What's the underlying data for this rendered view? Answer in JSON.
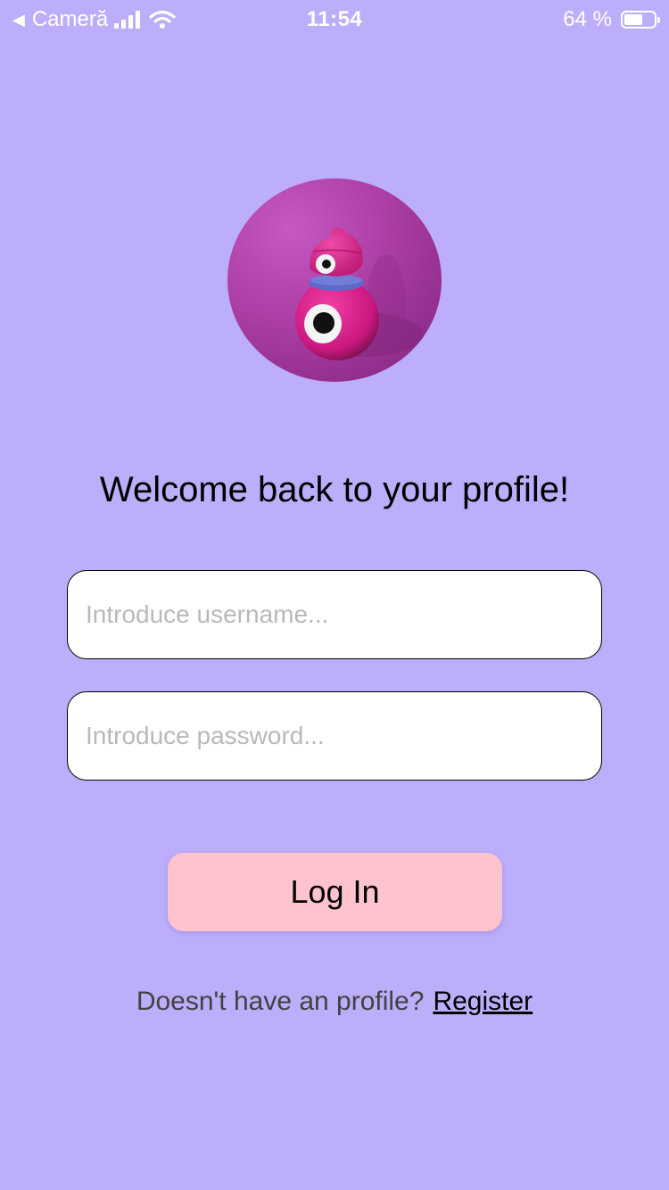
{
  "status_bar": {
    "back_label": "Cameră",
    "time": "11:54",
    "battery_text": "64 %",
    "battery_level": 0.64
  },
  "avatar": {
    "description_icon": "pink-monster-avatar"
  },
  "welcome": {
    "title": "Welcome back to your profile!"
  },
  "form": {
    "username_placeholder": "Introduce username...",
    "password_placeholder": "Introduce password...",
    "login_label": "Log In"
  },
  "footer": {
    "prompt": "Doesn't have an profile?",
    "register_label": "Register"
  },
  "colors": {
    "background": "#bcaefa",
    "button": "#ffc3ce"
  }
}
